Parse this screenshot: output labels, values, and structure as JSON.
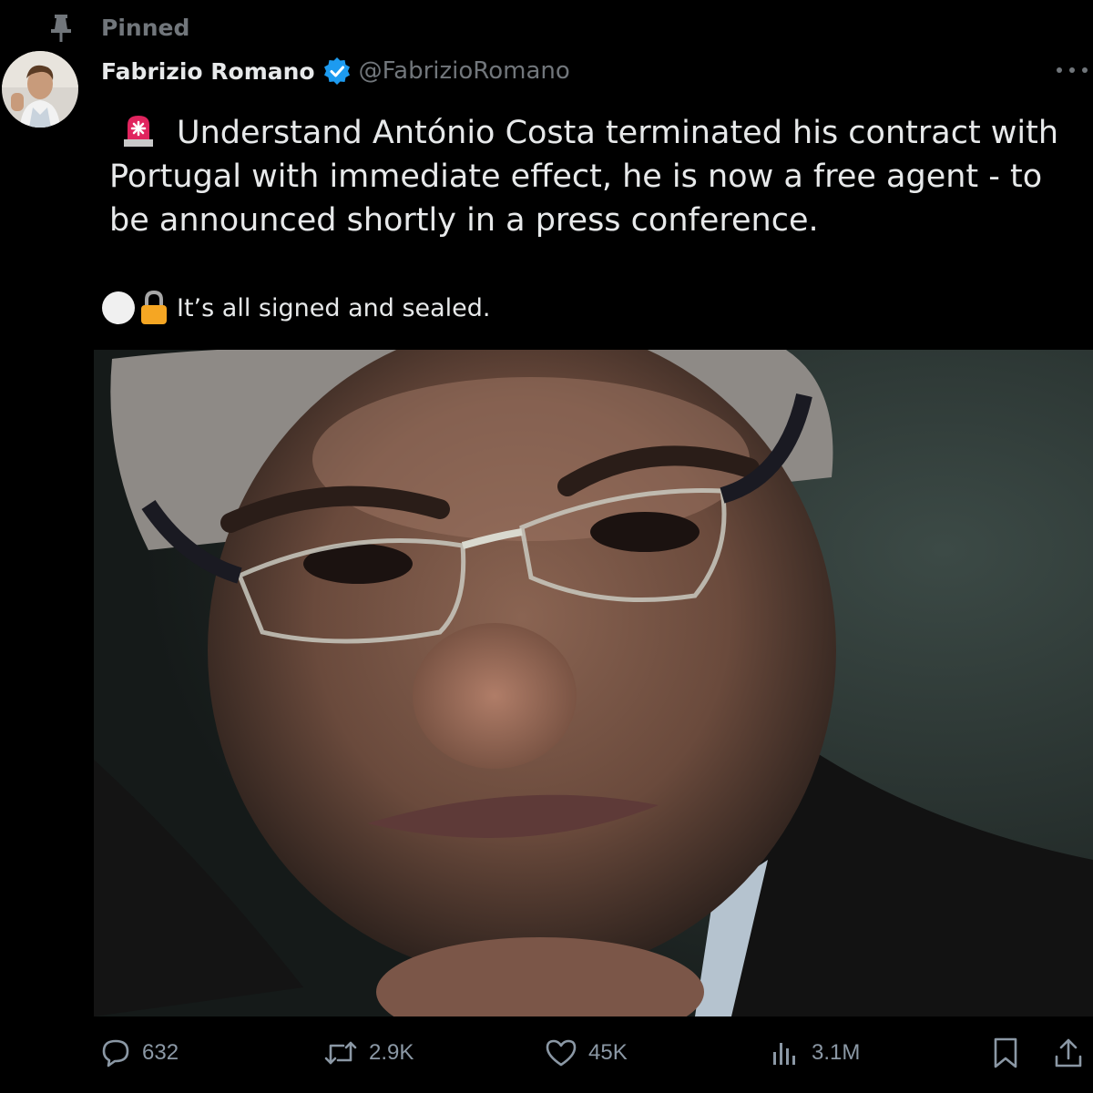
{
  "pinned": {
    "label": "Pinned",
    "icon": "pin-icon"
  },
  "author": {
    "name": "Fabrizio Romano",
    "handle": "@FabrizioRomano",
    "verified_icon": "verified-badge-icon",
    "avatar_icon": "avatar"
  },
  "tweet": {
    "text": "Understand António Costa terminated his contract with Portugal with immediate effect, he is now a free agent - to be announced shortly in a press conference.",
    "siren_icon": "siren-icon",
    "footer_text": "It’s all signed and sealed.",
    "footer_icons": [
      "white-circle-icon",
      "lock-icon"
    ]
  },
  "media": {
    "icon": "photo"
  },
  "actions": {
    "replies": {
      "icon": "reply-icon",
      "count": "632"
    },
    "reposts": {
      "icon": "repost-icon",
      "count": "2.9K"
    },
    "likes": {
      "icon": "heart-icon",
      "count": "45K"
    },
    "views": {
      "icon": "views-chart-icon",
      "count": "3.1M"
    },
    "bookmark": {
      "icon": "bookmark-icon"
    },
    "share": {
      "icon": "share-icon"
    }
  },
  "colors": {
    "background": "#000000",
    "text_primary": "#e7e9ea",
    "text_secondary": "#71767b",
    "verified_blue": "#1d9bf0",
    "siren_red": "#e0245e",
    "lock_orange": "#f5a623"
  }
}
